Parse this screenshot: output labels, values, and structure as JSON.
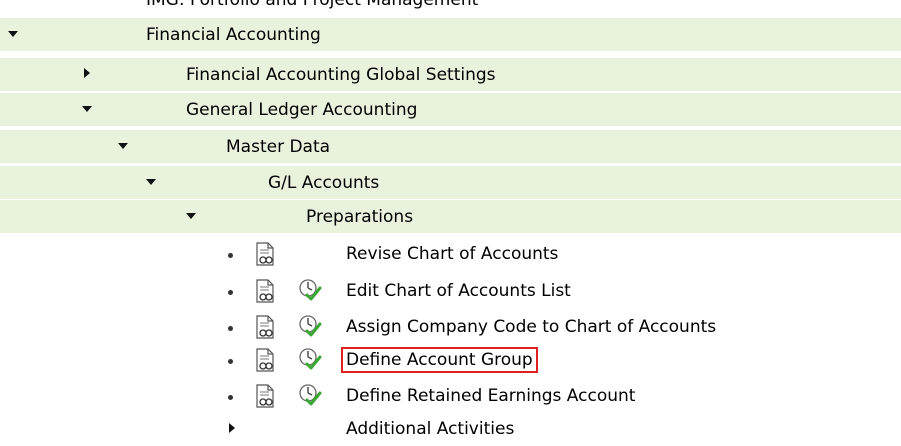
{
  "tree": {
    "partial_top_label": "IMG: Portfolio and Project Management",
    "nodes": [
      {
        "label": "Financial Accounting",
        "state": "expanded"
      },
      {
        "label": "Financial Accounting Global Settings",
        "state": "collapsed"
      },
      {
        "label": "General Ledger Accounting",
        "state": "expanded"
      },
      {
        "label": "Master Data",
        "state": "expanded"
      },
      {
        "label": "G/L Accounts",
        "state": "expanded"
      },
      {
        "label": "Preparations",
        "state": "expanded"
      }
    ],
    "activities": [
      {
        "label": "Revise Chart of Accounts",
        "has_execute_icon": false,
        "highlighted": false
      },
      {
        "label": "Edit Chart of Accounts List",
        "has_execute_icon": true,
        "highlighted": false
      },
      {
        "label": "Assign Company Code to Chart of Accounts",
        "has_execute_icon": true,
        "highlighted": false
      },
      {
        "label": "Define Account Group",
        "has_execute_icon": true,
        "highlighted": true
      },
      {
        "label": "Define Retained Earnings Account",
        "has_execute_icon": true,
        "highlighted": false
      }
    ],
    "trailing_node": {
      "label": "Additional Activities",
      "state": "collapsed"
    }
  },
  "icons": {
    "expanded": "triangle-down-icon",
    "collapsed": "triangle-right-icon",
    "documentation": "documentation-icon",
    "execute": "execute-activity-icon",
    "bullet": "bullet-icon"
  },
  "colors": {
    "row_shade": "#e9f2dc",
    "highlight_border": "#e02020",
    "execute_green": "#3aa832"
  }
}
